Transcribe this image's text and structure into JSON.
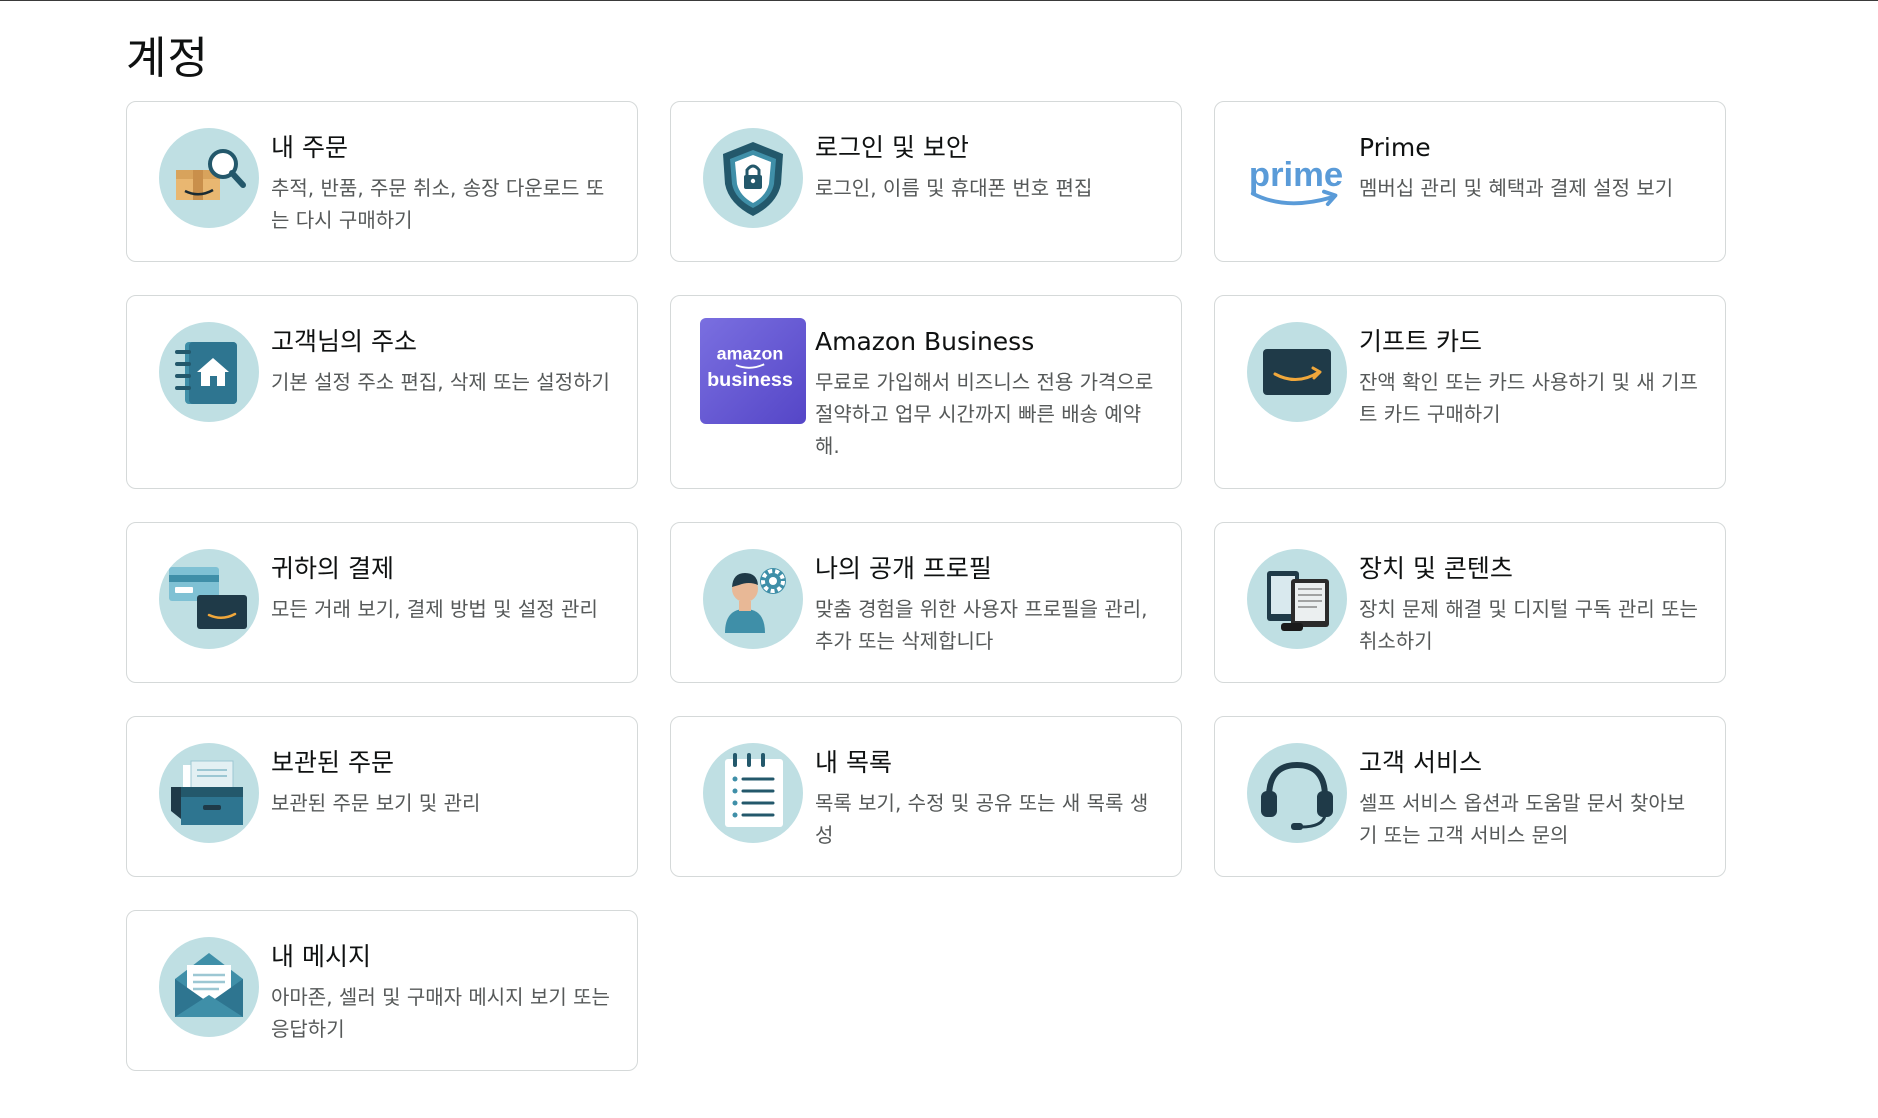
{
  "page": {
    "title": "계정"
  },
  "cards": [
    {
      "title": "내 주문",
      "desc": "추적, 반품, 주문 취소, 송장 다운로드 또는 다시 구매하기",
      "icon": "orders-icon"
    },
    {
      "title": "로그인 및 보안",
      "desc": "로그인, 이름 및 휴대폰 번호 편집",
      "icon": "security-shield-icon"
    },
    {
      "title": "Prime",
      "desc": "멤버십 관리 및 혜택과 결제 설정 보기",
      "icon": "prime-logo-icon",
      "logo_text": "prime"
    },
    {
      "title": "고객님의 주소",
      "desc": "기본 설정 주소 편집, 삭제 또는 설정하기",
      "icon": "address-book-icon"
    },
    {
      "title": "Amazon Business",
      "desc": "무료로 가입해서 비즈니스 전용 가격으로 절약하고 업무 시간까지 빠른 배송 예약해.",
      "icon": "amazon-business-logo-icon",
      "logo_line1": "amazon",
      "logo_line2": "business"
    },
    {
      "title": "기프트 카드",
      "desc": "잔액 확인 또는 카드 사용하기 및 새 기프트 카드 구매하기",
      "icon": "gift-card-icon"
    },
    {
      "title": "귀하의 결제",
      "desc": "모든 거래 보기, 결제 방법 및 설정 관리",
      "icon": "payment-cards-icon"
    },
    {
      "title": "나의 공개 프로필",
      "desc": "맞춤 경험을 위한 사용자 프로필을 관리, 추가 또는 삭제합니다",
      "icon": "profile-settings-icon"
    },
    {
      "title": "장치 및 콘텐츠",
      "desc": "장치 문제 해결 및 디지털 구독 관리 또는 취소하기",
      "icon": "devices-icon"
    },
    {
      "title": "보관된 주문",
      "desc": "보관된 주문 보기 및 관리",
      "icon": "archive-box-icon"
    },
    {
      "title": "내 목록",
      "desc": "목록 보기, 수정 및 공유 또는 새 목록 생성",
      "icon": "list-notepad-icon"
    },
    {
      "title": "고객 서비스",
      "desc": "셀프 서비스 옵션과 도움말 문서 찾아보기 또는 고객 서비스 문의",
      "icon": "headset-icon"
    },
    {
      "title": "내 메시지",
      "desc": "아마존, 셀러 및 구매자 메시지 보기 또는 응답하기",
      "icon": "envelope-icon"
    }
  ],
  "colors": {
    "icon_bg": "#bfdfe3",
    "dark_teal": "#23586b",
    "mid_teal": "#3f8fa8",
    "prime_blue": "#5a9bd8",
    "amazon_orange": "#f0a73b",
    "business_purple": "#6656d4"
  }
}
